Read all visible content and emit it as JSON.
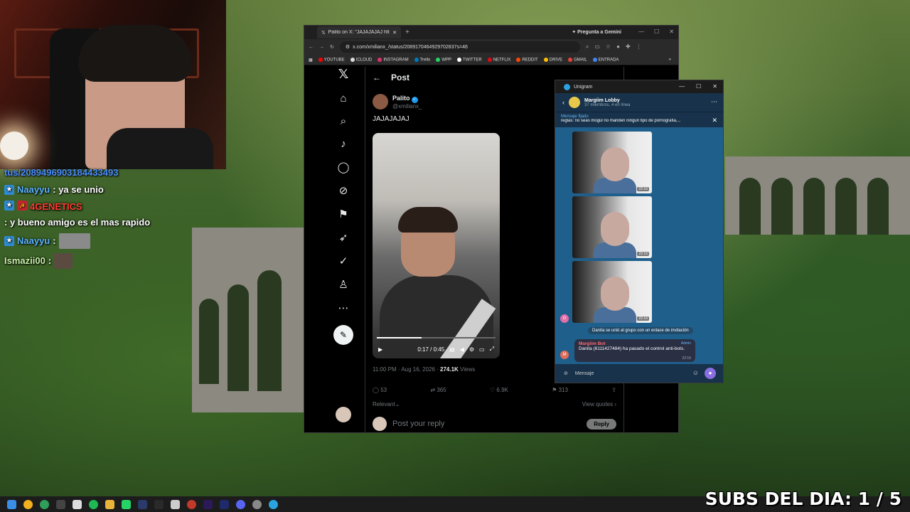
{
  "chat": {
    "url_fragment": "tus/2089496903184433493",
    "messages": [
      {
        "user": "Naayyu",
        "text": ": ya se unio"
      },
      {
        "user": "4GENETICS",
        "text": ": y bueno amigo es el mas rapido"
      },
      {
        "user": "Naayyu",
        "text": ":"
      },
      {
        "user": "Ismazii00",
        "text": ":"
      }
    ]
  },
  "browser": {
    "tab_title": "Palito on X: \"JAJAJAJAJ http",
    "gemini_label": "Pregunta a Gemini",
    "url": "x.com/xmilianx_/status/2089170464929702837s=46",
    "bookmarks": [
      "YOUTUBE",
      "ICLOUD",
      "INSTAGRAM",
      "Trello",
      "WPP",
      "TWITTER",
      "NETFLIX",
      "REDDIT",
      "DRIVE",
      "GMAIL",
      "ENTRADA"
    ]
  },
  "x": {
    "header": "Post",
    "author_name": "Palito",
    "author_handle": "@xmilianx_",
    "tweet_text": "JAJAJAJAJ",
    "video_time": "0:17 / 0:45",
    "video_progress": 0.38,
    "timestamp": "11:00 PM · Aug 16, 2026 · ",
    "views_count": "274.1K",
    "views_label": " Views",
    "replies": "53",
    "reposts": "365",
    "likes": "6.9K",
    "bookmarks": "313",
    "relevant": "Relevant",
    "view_quotes": "View quotes",
    "reply_placeholder": "Post your reply",
    "reply_button": "Reply"
  },
  "unigram": {
    "app_title": "Unigram",
    "group_name": "Margiim Lobby",
    "group_status": "37 miembros, 4 en línea",
    "pinned_label": "Mensaje fijado",
    "pinned_text": "reglas: no seas mogul no manden ningun tipo de pornografia,...",
    "video_times": [
      "22:16",
      "22:16",
      "22:16"
    ],
    "system_msg": "Danita se unió al grupo con un enlace de invitación",
    "bot_name": "Margiim Bot",
    "bot_admin": "Admin",
    "bot_text": "Danita (6111427484) ha pasado el control anti-bots.",
    "bot_time": "22:16",
    "composer_placeholder": "Mensaje"
  },
  "overlay": {
    "subs": "SUBS DEL DIA: 1 / 5"
  }
}
